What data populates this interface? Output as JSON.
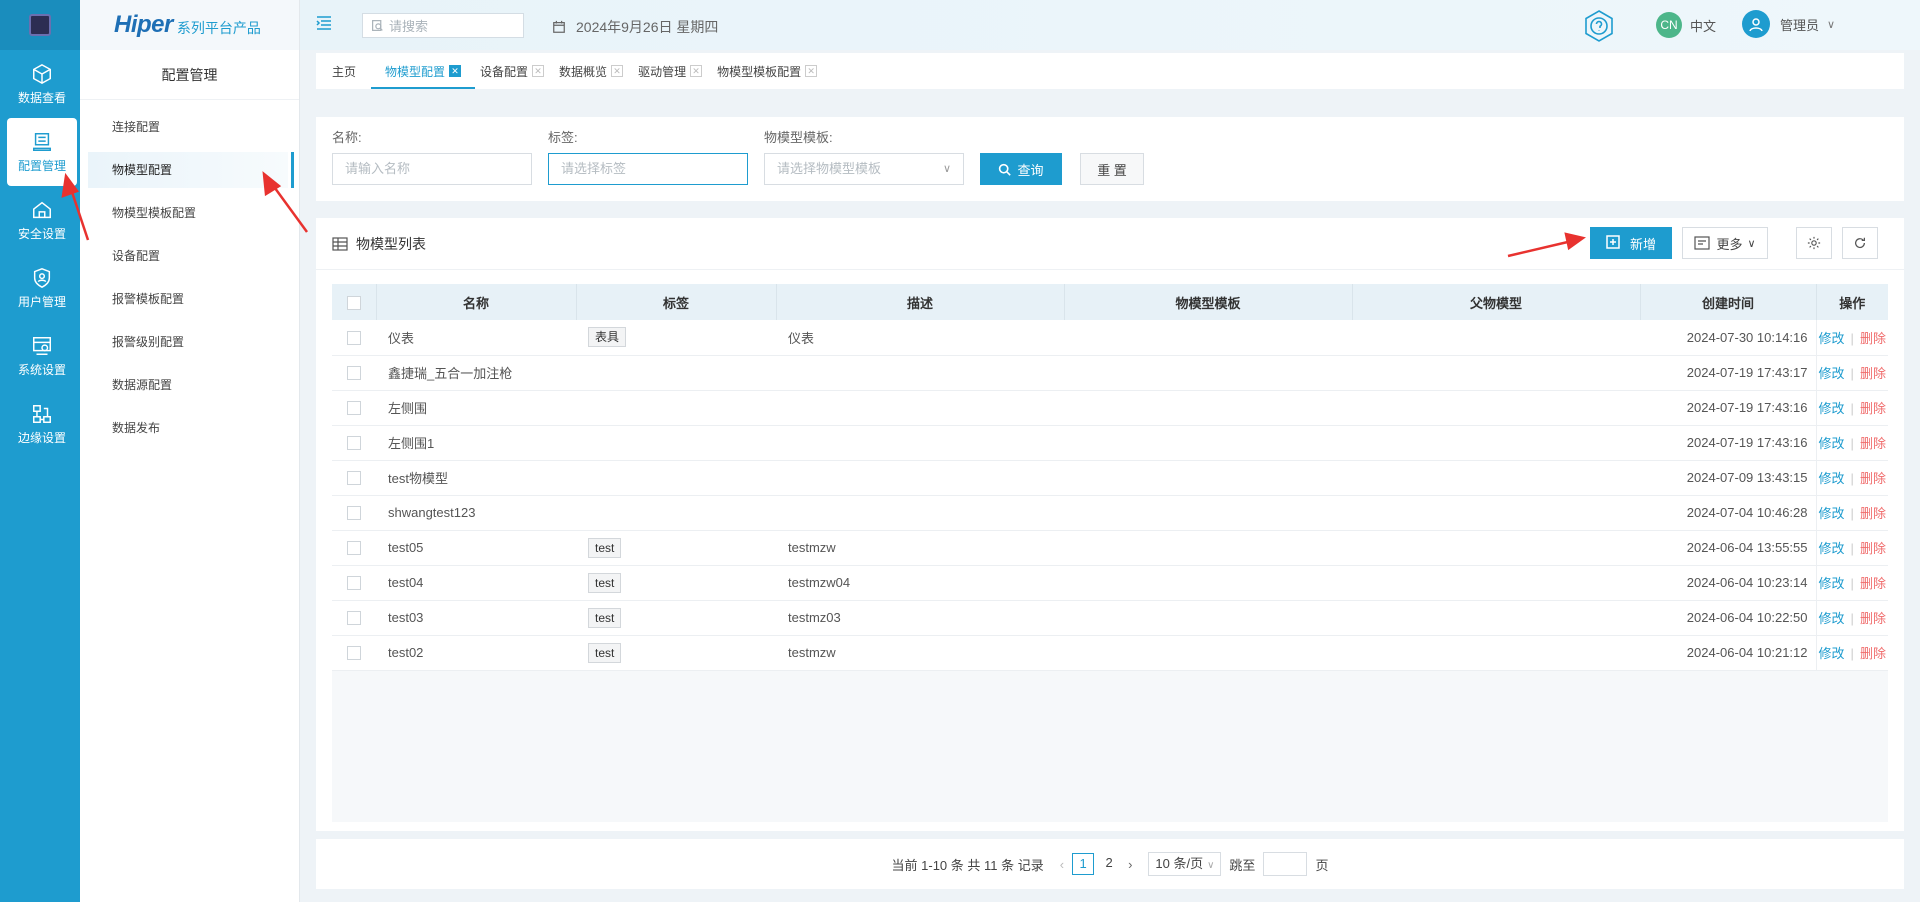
{
  "rail": {
    "items": [
      {
        "label": "数据查看",
        "icon": "cube-icon"
      },
      {
        "label": "配置管理",
        "icon": "config-icon",
        "active": true
      },
      {
        "label": "安全设置",
        "icon": "home-shield-icon"
      },
      {
        "label": "用户管理",
        "icon": "user-shield-icon"
      },
      {
        "label": "系统设置",
        "icon": "system-gear-icon"
      },
      {
        "label": "边缘设置",
        "icon": "edge-network-icon"
      }
    ]
  },
  "brand": {
    "name": "Hiper",
    "tagline": "系列平台产品"
  },
  "submenu": {
    "title": "配置管理",
    "items": [
      {
        "label": "连接配置"
      },
      {
        "label": "物模型配置",
        "active": true
      },
      {
        "label": "物模型模板配置"
      },
      {
        "label": "设备配置"
      },
      {
        "label": "报警模板配置"
      },
      {
        "label": "报警级别配置"
      },
      {
        "label": "数据源配置"
      },
      {
        "label": "数据发布"
      }
    ]
  },
  "header": {
    "search_placeholder": "请搜索",
    "date": "2024年9月26日 星期四",
    "lang_badge": "CN",
    "lang_label": "中文",
    "user_label": "管理员"
  },
  "tabs": [
    {
      "label": "主页",
      "closable": false
    },
    {
      "label": "物模型配置",
      "active": true,
      "closable": true
    },
    {
      "label": "设备配置",
      "closable": true
    },
    {
      "label": "数据概览",
      "closable": true
    },
    {
      "label": "驱动管理",
      "closable": true
    },
    {
      "label": "物模型模板配置",
      "closable": true
    }
  ],
  "filter": {
    "name_label": "名称:",
    "name_placeholder": "请输入名称",
    "tag_label": "标签:",
    "tag_placeholder": "请选择标签",
    "template_label": "物模型模板:",
    "template_placeholder": "请选择物模型模板",
    "query_label": "查询",
    "reset_label": "重 置"
  },
  "list": {
    "title": "物模型列表",
    "add_label": "新增",
    "more_label": "更多",
    "columns": [
      "名称",
      "标签",
      "描述",
      "物模型模板",
      "父物模型",
      "创建时间",
      "操作"
    ],
    "edit_label": "修改",
    "delete_label": "删除",
    "rows": [
      {
        "name": "仪表",
        "tag": "表具",
        "desc": "仪表",
        "template": "",
        "parent": "",
        "created": "2024-07-30 10:14:16"
      },
      {
        "name": "鑫捷瑞_五合一加注枪",
        "tag": "",
        "desc": "",
        "template": "",
        "parent": "",
        "created": "2024-07-19 17:43:17"
      },
      {
        "name": "左侧围",
        "tag": "",
        "desc": "",
        "template": "",
        "parent": "",
        "created": "2024-07-19 17:43:16"
      },
      {
        "name": "左侧围1",
        "tag": "",
        "desc": "",
        "template": "",
        "parent": "",
        "created": "2024-07-19 17:43:16"
      },
      {
        "name": "test物模型",
        "tag": "",
        "desc": "",
        "template": "",
        "parent": "",
        "created": "2024-07-09 13:43:15"
      },
      {
        "name": "shwangtest123",
        "tag": "",
        "desc": "",
        "template": "",
        "parent": "",
        "created": "2024-07-04 10:46:28"
      },
      {
        "name": "test05",
        "tag": "test",
        "desc": "testmzw",
        "template": "",
        "parent": "",
        "created": "2024-06-04 13:55:55"
      },
      {
        "name": "test04",
        "tag": "test",
        "desc": "testmzw04",
        "template": "",
        "parent": "",
        "created": "2024-06-04 10:23:14"
      },
      {
        "name": "test03",
        "tag": "test",
        "desc": "testmz03",
        "template": "",
        "parent": "",
        "created": "2024-06-04 10:22:50"
      },
      {
        "name": "test02",
        "tag": "test",
        "desc": "testmzw",
        "template": "",
        "parent": "",
        "created": "2024-06-04 10:21:12"
      }
    ]
  },
  "pager": {
    "summary": "当前 1-10 条 共 11 条 记录",
    "pages": [
      "1",
      "2"
    ],
    "current": "1",
    "page_size": "10 条/页",
    "jump_label": "跳至",
    "page_suffix": "页"
  },
  "colors": {
    "accent": "#1e9ccf",
    "danger": "#f06b6b",
    "annotation": "#e8322f"
  }
}
